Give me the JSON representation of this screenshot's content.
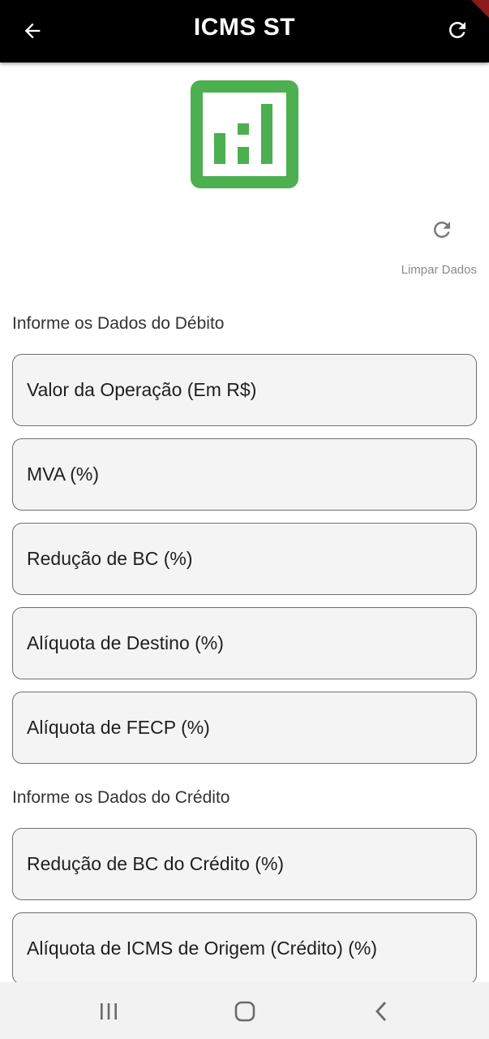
{
  "app_bar": {
    "title": "ICMS ST",
    "back_icon": "arrow-back-icon",
    "refresh_icon": "refresh-icon"
  },
  "logo": {
    "icon": "bar-chart-box-icon",
    "color": "#4caf50"
  },
  "clear_data": {
    "icon": "refresh-icon",
    "label": "Limpar Dados"
  },
  "debit_section": {
    "title": "Informe os Dados do Débito",
    "fields": [
      {
        "label": "Valor da Operação (Em R$)"
      },
      {
        "label": "MVA (%)"
      },
      {
        "label": "Redução de BC (%)"
      },
      {
        "label": "Alíquota de Destino (%)"
      },
      {
        "label": "Alíquota de FECP (%)"
      }
    ]
  },
  "credit_section": {
    "title": "Informe os Dados do Crédito",
    "fields": [
      {
        "label": "Redução de BC do Crédito (%)"
      },
      {
        "label": "Alíquota de ICMS de Origem (Crédito) (%)"
      }
    ]
  },
  "system_nav": {
    "recents_icon": "recent-apps-icon",
    "home_icon": "home-icon",
    "back_icon": "nav-back-icon"
  },
  "colors": {
    "app_bar": "#000000",
    "accent": "#4caf50",
    "field_background": "#f4f4f4",
    "field_border": "#6f6f6f"
  }
}
